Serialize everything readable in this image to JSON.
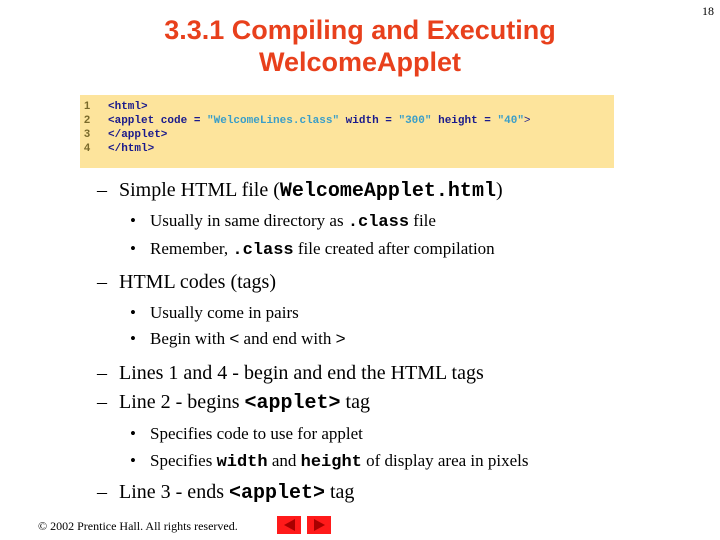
{
  "slide": {
    "page_number": "18",
    "title_line1": "3.3.1  Compiling and Executing",
    "title_line2": "WelcomeApplet"
  },
  "code": {
    "lines": [
      {
        "num": "1",
        "parts": [
          {
            "t": "<html>",
            "c": "tag"
          }
        ]
      },
      {
        "num": "2",
        "parts": [
          {
            "t": "<applet code = ",
            "c": "tag"
          },
          {
            "t": "\"WelcomeLines.class\"",
            "c": "str"
          },
          {
            "t": " width = ",
            "c": "tag"
          },
          {
            "t": "\"300\"",
            "c": "str"
          },
          {
            "t": " height = ",
            "c": "tag"
          },
          {
            "t": "\"40\"",
            "c": "str"
          },
          {
            "t": ">",
            "c": "punct"
          }
        ]
      },
      {
        "num": "3",
        "parts": [
          {
            "t": "</applet>",
            "c": "tag"
          }
        ]
      },
      {
        "num": "4",
        "parts": [
          {
            "t": "</html>",
            "c": "tag"
          }
        ]
      }
    ]
  },
  "bullets": {
    "b1": {
      "dash": "–",
      "pre": "Simple HTML file (",
      "mono": "WelcomeApplet.html",
      "post": ")"
    },
    "b1a": {
      "dot": "•",
      "pre": "Usually in same directory as ",
      "mono": ".class",
      "post": " file"
    },
    "b1b": {
      "dot": "•",
      "pre": "Remember, ",
      "mono": ".class",
      "post": " file created after compilation"
    },
    "b2": {
      "dash": "–",
      "text": "HTML codes (tags)"
    },
    "b2a": {
      "dot": "•",
      "text": "Usually come in pairs"
    },
    "b2b": {
      "dot": "•",
      "pre": "Begin with ",
      "lt": "<",
      "mid": " and end with ",
      "gt": ">"
    },
    "b3": {
      "dash": "–",
      "text": "Lines 1 and 4 - begin and end the HTML tags"
    },
    "b4": {
      "dash": "–",
      "pre": "Line 2 - begins ",
      "mono": "<applet>",
      "post": " tag"
    },
    "b4a": {
      "dot": "•",
      "text": "Specifies code to use for applet"
    },
    "b4b": {
      "dot": "•",
      "pre": "Specifies ",
      "mono1": "width",
      "mid": " and ",
      "mono2": "height",
      "post": " of display area in pixels"
    },
    "b5": {
      "dash": "–",
      "pre": "Line 3 - ends ",
      "mono": "<applet>",
      "post": " tag"
    }
  },
  "footer": {
    "copyright": "© 2002 Prentice Hall.  All rights reserved.",
    "prev_icon": "arrow-left-icon",
    "next_icon": "arrow-right-icon"
  },
  "colors": {
    "title": "#e8401c",
    "code_bg": "#fde49c",
    "code_tag": "#1a1a8c",
    "code_string": "#3a9ec8",
    "nav_button": "#ff1a1a"
  }
}
